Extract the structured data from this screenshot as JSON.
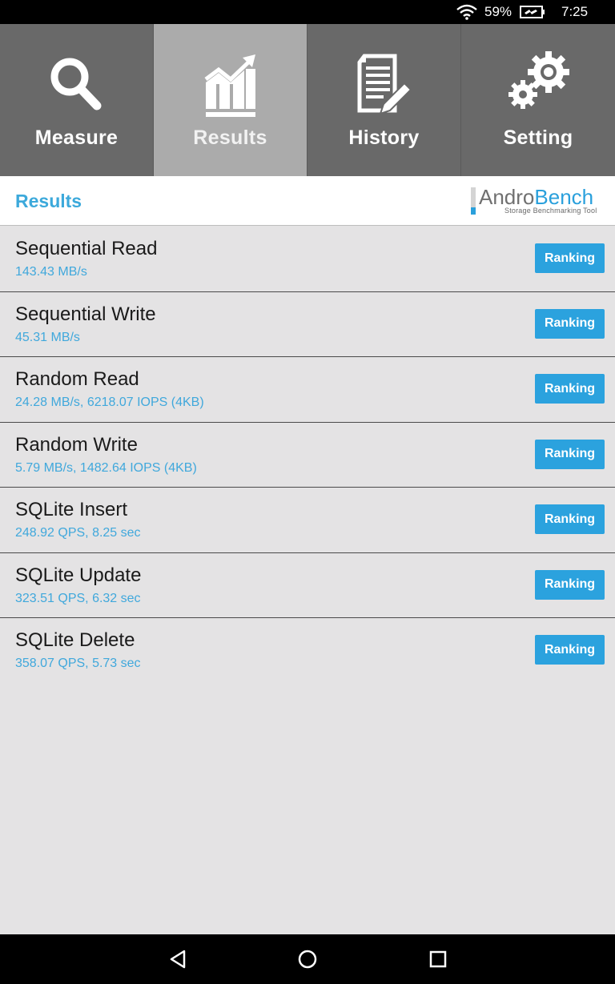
{
  "status_bar": {
    "battery_percent": "59%",
    "time": "7:25",
    "icons": [
      "wifi-icon",
      "battery-charging-icon"
    ]
  },
  "tabs": [
    {
      "label": "Measure",
      "icon": "search-icon",
      "active": false
    },
    {
      "label": "Results",
      "icon": "chart-trend-icon",
      "active": true
    },
    {
      "label": "History",
      "icon": "document-edit-icon",
      "active": false
    },
    {
      "label": "Setting",
      "icon": "gears-icon",
      "active": false
    }
  ],
  "header": {
    "title": "Results",
    "logo": {
      "name_part1": "Andro",
      "name_part2": "Bench",
      "tagline": "Storage Benchmarking Tool"
    }
  },
  "results": [
    {
      "name": "Sequential Read",
      "value": "143.43 MB/s",
      "button": "Ranking"
    },
    {
      "name": "Sequential Write",
      "value": "45.31 MB/s",
      "button": "Ranking"
    },
    {
      "name": "Random Read",
      "value": "24.28 MB/s, 6218.07 IOPS (4KB)",
      "button": "Ranking"
    },
    {
      "name": "Random Write",
      "value": "5.79 MB/s, 1482.64 IOPS (4KB)",
      "button": "Ranking"
    },
    {
      "name": "SQLite Insert",
      "value": "248.92 QPS, 8.25 sec",
      "button": "Ranking"
    },
    {
      "name": "SQLite Update",
      "value": "323.51 QPS, 6.32 sec",
      "button": "Ranking"
    },
    {
      "name": "SQLite Delete",
      "value": "358.07 QPS, 5.73 sec",
      "button": "Ranking"
    }
  ],
  "nav_bar": {
    "buttons": [
      "back-icon",
      "home-icon",
      "recents-icon"
    ]
  },
  "colors": {
    "accent": "#2ba2de",
    "tab_bg": "#696969",
    "tab_active_bg": "#ababab",
    "list_bg": "#e4e3e4"
  }
}
